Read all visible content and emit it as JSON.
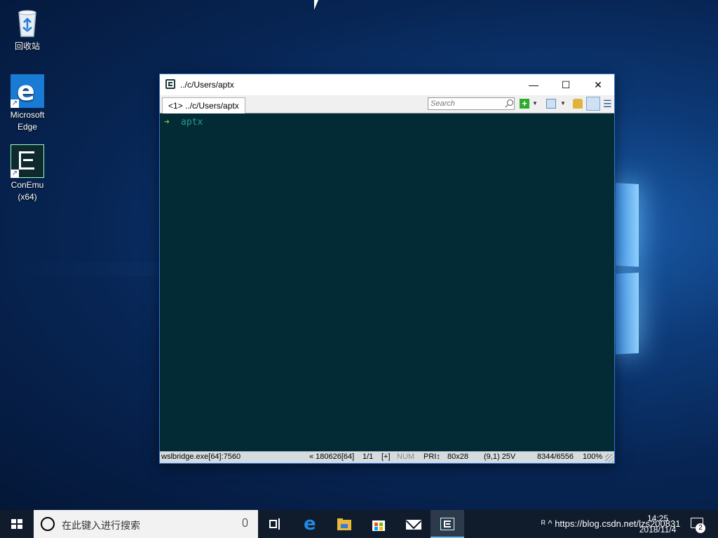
{
  "desktop": {
    "icons": [
      {
        "label": "回收站",
        "icon": "recycle-bin-icon"
      },
      {
        "label": "Microsoft Edge",
        "icon": "edge-icon"
      },
      {
        "label": "ConEmu (x64)",
        "icon": "conemu-icon"
      }
    ]
  },
  "window": {
    "title": "../c/Users/aptx",
    "tab_label": "<1> ../c/Users/aptx",
    "search_placeholder": "Search",
    "controls": {
      "minimize": "—",
      "maximize": "☐",
      "close": "✕"
    },
    "toolbar": {
      "new_console": "+",
      "dropdown": "▼",
      "menu": "☰"
    },
    "console": {
      "prompt_symbol": "➜",
      "directory": "aptx"
    },
    "status": {
      "process": "wslbridge.exe[64]:7560",
      "build": "« 180626[64]",
      "console_index": "1/1",
      "plus": "[+]",
      "num": "NUM",
      "pri": "PRI↕",
      "size": "80x28",
      "cursor": "(9,1) 25V",
      "buffer": "8344/6556",
      "zoom": "100%"
    }
  },
  "taskbar": {
    "search_placeholder": "在此键入进行搜索",
    "apps": [
      {
        "name": "task-view",
        "icon": "task-view-icon"
      },
      {
        "name": "edge",
        "icon": "edge-icon"
      },
      {
        "name": "file-explorer",
        "icon": "folder-icon"
      },
      {
        "name": "store",
        "icon": "store-icon"
      },
      {
        "name": "mail",
        "icon": "mail-icon"
      },
      {
        "name": "conemu",
        "icon": "conemu-icon"
      }
    ],
    "tray_text": "ᴿ ^ https://blog.csdn.net/lzs200831",
    "time": "14:25",
    "date": "2018/11/4",
    "notification_count": "2"
  },
  "colors": {
    "console_bg": "#022b35",
    "prompt_arrow": "#6ec03a",
    "prompt_dir": "#2a9d8f",
    "taskbar_bg": "#101b2c",
    "accent": "#2b79d7"
  }
}
